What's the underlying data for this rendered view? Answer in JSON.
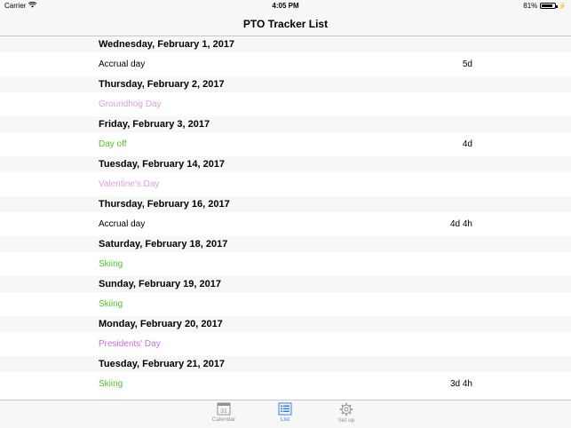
{
  "status": {
    "carrier": "Carrier",
    "time": "4:05 PM",
    "battery": "81%",
    "battery_level": 0.81
  },
  "nav": {
    "title": "PTO Tracker List"
  },
  "sections": [
    {
      "date": "Wednesday, February 1, 2017",
      "title": "Accrual day",
      "value": "5d",
      "color": "#000000"
    },
    {
      "date": "Thursday, February 2, 2017",
      "title": "Groundhog Day",
      "value": "",
      "color": "#e29be0"
    },
    {
      "date": "Friday, February 3, 2017",
      "title": "Day off",
      "value": "4d",
      "color": "#53c22b"
    },
    {
      "date": "Tuesday, February 14, 2017",
      "title": "Valentine's Day",
      "value": "",
      "color": "#e29be0"
    },
    {
      "date": "Thursday, February 16, 2017",
      "title": "Accrual day",
      "value": "4d 4h",
      "color": "#000000"
    },
    {
      "date": "Saturday, February 18, 2017",
      "title": "Skiing",
      "value": "",
      "color": "#53c22b"
    },
    {
      "date": "Sunday, February 19, 2017",
      "title": "Skiing",
      "value": "",
      "color": "#53c22b"
    },
    {
      "date": "Monday, February 20, 2017",
      "title": "Presidents' Day",
      "value": "",
      "color": "#c86fd6"
    },
    {
      "date": "Tuesday, February 21, 2017",
      "title": "Skiing",
      "value": "3d 4h",
      "color": "#53c22b"
    }
  ],
  "tabs": [
    {
      "label": "Calendar",
      "icon": "calendar-icon",
      "glyph": "31",
      "active": false
    },
    {
      "label": "List",
      "icon": "list-icon",
      "active": true
    },
    {
      "label": "Set up",
      "icon": "gear-icon",
      "active": false
    }
  ],
  "colors": {
    "accent": "#2f7cf6",
    "inactive": "#929292"
  }
}
